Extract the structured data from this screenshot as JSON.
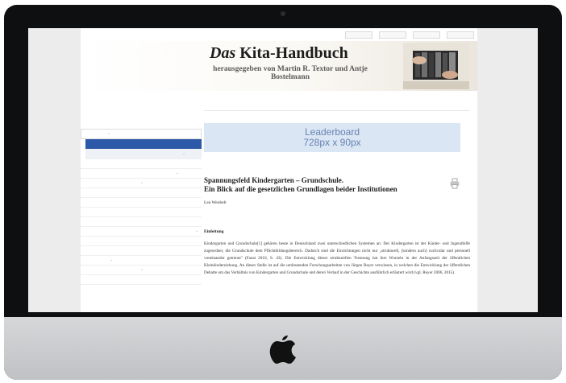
{
  "site": {
    "title_prefix": "Das",
    "title_main": "Kita-Handbuch",
    "subtitle": "herausgegeben von Martin R. Textor und Antje Bostelmann"
  },
  "top_links": [
    "",
    "",
    "",
    ""
  ],
  "nav": {
    "tabs": [
      {
        "label": "",
        "active": true
      },
      {
        "label": "",
        "active": false
      },
      {
        "label": "",
        "active": false
      }
    ]
  },
  "sidebar": {
    "heading": "",
    "items": [
      {
        "label": "",
        "state": "first",
        "caret": "⌄"
      },
      {
        "label": "",
        "state": "selected"
      },
      {
        "label": "",
        "state": "sub",
        "caret": "⌄"
      },
      {
        "label": ""
      },
      {
        "label": "",
        "caret": "⌄"
      },
      {
        "label": "",
        "caret": "⌄"
      },
      {
        "label": ""
      },
      {
        "label": ""
      },
      {
        "label": ""
      },
      {
        "label": ""
      },
      {
        "label": "",
        "caret": "⌄"
      },
      {
        "label": ""
      },
      {
        "label": ""
      },
      {
        "label": "",
        "caret": "⌄"
      },
      {
        "label": "",
        "caret": "⌄"
      },
      {
        "label": ""
      }
    ]
  },
  "ad": {
    "label": "",
    "line1": "Leaderboard",
    "line2": "728px x 90px"
  },
  "breadcrumb": "",
  "article": {
    "title_line1": "Spannungsfeld Kindergarten – Grundschule.",
    "title_line2": "Ein Blick auf die gesetzlichen Grundlagen beider Institutionen",
    "author": "Lea Weubelt",
    "section_heading": "Einleitung",
    "body": "Kindergarten und Grundschule[1] gehören heute in Deutschland zwei unterschiedlichen Systemen an: Der Kindergarten ist der Kinder- und Jugendhilfe zugeordnet, die Grundschule dem Pflichtbildungsbereich. Dadurch sind die Einrichtungen nicht nur „strukturell, [sondern auch] curricular und personell voneinander getrennt\" (Faust 2010, S. 43). Die Entwicklung dieser strukturellen Trennung hat ihre Wurzeln in der Anfangszeit der öffentlichen Kleinkinderziehung. An dieser Stelle ist auf die umfassenden Forschungsarbeiten von Jürgen Reyer verwiesen, in welchen die Entwicklung der öffentlichen Debatte um das Verhältnis von Kindergarten und Grundschule und deren Verlauf in der Geschichte ausführlich erläutert wird (vgl. Reyer 2006, 2015)."
  },
  "colors": {
    "accent": "#2c5aa8",
    "ad_background": "#dbe6f5",
    "bezel": "#0e0f10",
    "chin": "#c9cbce"
  },
  "icons": {
    "print": "print-icon",
    "brand": "apple-logo"
  }
}
